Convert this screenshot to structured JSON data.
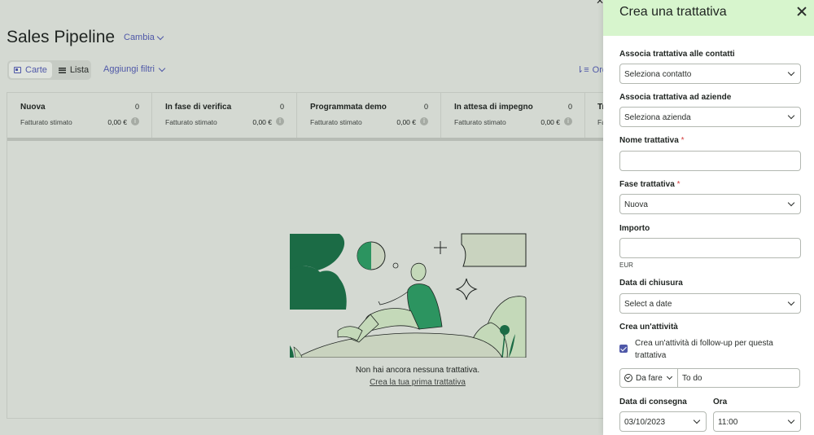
{
  "header": {
    "page_title": "Sales Pipeline",
    "cambia_label": "Cambia",
    "view_cards_label": "Carte",
    "view_list_label": "Lista",
    "add_filters_label": "Aggiungi filtri",
    "sort_label": "Ord"
  },
  "columns": [
    {
      "name": "Nuova",
      "count": "0",
      "sub_label": "Fatturato stimato",
      "amount": "0,00 €"
    },
    {
      "name": "In fase di verifica",
      "count": "0",
      "sub_label": "Fatturato stimato",
      "amount": "0,00 €"
    },
    {
      "name": "Programmata demo",
      "count": "0",
      "sub_label": "Fatturato stimato",
      "amount": "0,00 €"
    },
    {
      "name": "In attesa di impegno",
      "count": "0",
      "sub_label": "Fatturato stimato",
      "amount": "0,00 €"
    },
    {
      "name": "Tr",
      "count": "",
      "sub_label": "Fattu",
      "amount": ""
    }
  ],
  "empty_state": {
    "title": "Non hai ancora nessuna trattativa.",
    "link": "Crea la tua prima trattativa"
  },
  "panel": {
    "title": "Crea una trattativa",
    "contacts": {
      "label": "Associa trattativa alle contatti",
      "value": "Seleziona contatto"
    },
    "companies": {
      "label": "Associa trattativa ad aziende",
      "value": "Seleziona azienda"
    },
    "deal_name": {
      "label": "Nome trattativa",
      "required": "*",
      "value": ""
    },
    "stage": {
      "label": "Fase trattativa",
      "required": "*",
      "value": "Nuova"
    },
    "amount": {
      "label": "Importo",
      "value": "",
      "currency": "EUR"
    },
    "close_date": {
      "label": "Data di chiusura",
      "value": "Select a date"
    },
    "activity": {
      "label": "Crea un'attività",
      "checkbox_label": "Crea un'attività di follow-up per questa trattativa",
      "checked": true,
      "type_value": "Da fare",
      "name_value": "To do"
    },
    "due_date": {
      "label": "Data di consegna",
      "value": "03/10/2023"
    },
    "time": {
      "label": "Ora",
      "value": "11:00"
    }
  },
  "colors": {
    "accent": "#4f58a8",
    "panel_header": "#d7f5cd",
    "illustration_dark": "#1b6b45",
    "illustration_mid": "#2c9460",
    "illustration_light": "#c4d9b9"
  }
}
